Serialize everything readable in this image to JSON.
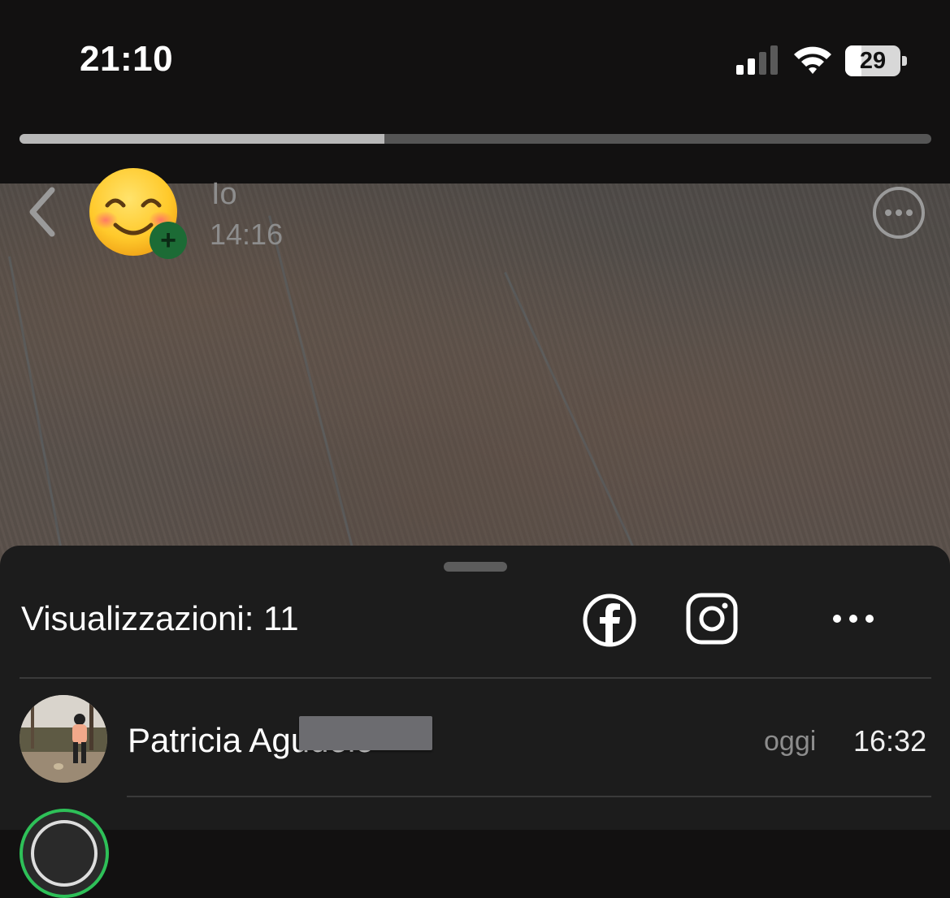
{
  "status_bar": {
    "time": "21:10",
    "battery_level": "29",
    "battery_fraction": 0.29,
    "icons": [
      "signal-icon",
      "wifi-icon",
      "battery-icon"
    ]
  },
  "story": {
    "progress_fraction": 0.4,
    "owner_name": "Io",
    "posted_time": "14:16",
    "icons": [
      "back-chevron-icon",
      "smiling-emoji-avatar",
      "add-badge-icon",
      "more-options-icon"
    ]
  },
  "viewers_sheet": {
    "views_label": "Visualizzazioni: 11",
    "share_icons": [
      "facebook-icon",
      "instagram-icon",
      "more-dots-icon"
    ],
    "viewers": [
      {
        "name": "Patricia Agudelo",
        "day": "oggi",
        "time": "16:32"
      }
    ]
  },
  "colors": {
    "background": "#121111",
    "sheet": "#1c1c1c",
    "secondary_text": "#8d8d8d",
    "story_ring": "#2ec058",
    "add_badge": "#1c6b35"
  }
}
